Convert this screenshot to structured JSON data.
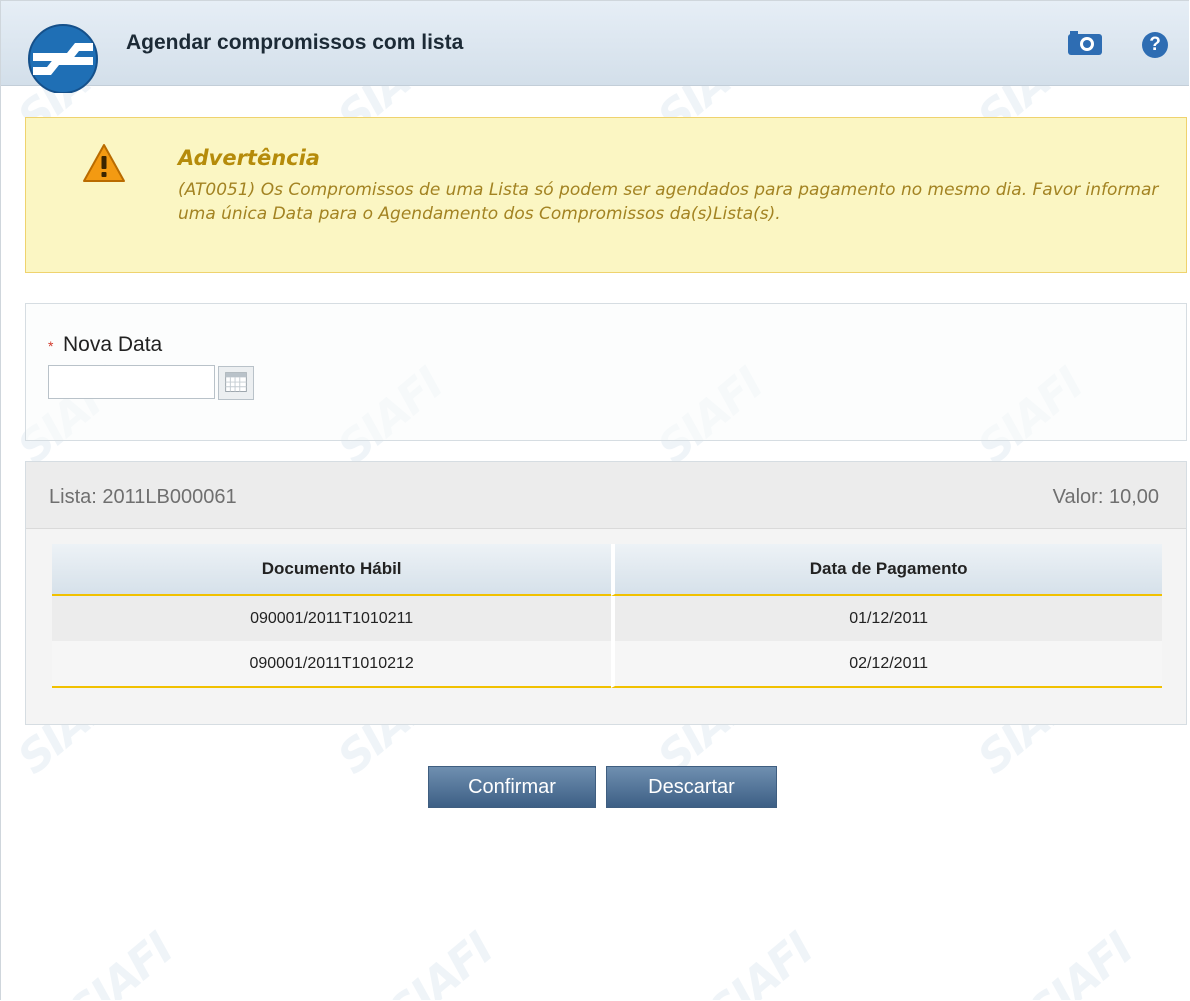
{
  "header": {
    "title": "Agendar compromissos com lista",
    "camera_icon": "camera-icon",
    "help_icon": "help-icon",
    "help_label": "?"
  },
  "warning": {
    "title": "Advertência",
    "message": "(AT0051) Os Compromissos de uma Lista só podem ser agendados para pagamento no mesmo dia. Favor informar uma única Data para o Agendamento dos Compromissos da(s)Lista(s).",
    "icon": "warning-icon"
  },
  "form": {
    "required_mark": "*",
    "date_label": "Nova Data",
    "date_value": "",
    "calendar_icon": "calendar-icon"
  },
  "list": {
    "label": "Lista: 2011LB000061",
    "value": "Valor: 10,00",
    "columns": [
      "Documento Hábil",
      "Data de Pagamento"
    ],
    "rows": [
      {
        "documento": "090001/2011T1010211",
        "data": "01/12/2011"
      },
      {
        "documento": "090001/2011T1010212",
        "data": "02/12/2011"
      }
    ]
  },
  "actions": {
    "confirm": "Confirmar",
    "discard": "Descartar"
  },
  "colors": {
    "header_bg": "#d3dfea",
    "warning_bg": "#fbf6c3",
    "warning_text": "#b58b0a",
    "button_bg": "#3d5f85",
    "table_accent": "#f1c100"
  }
}
